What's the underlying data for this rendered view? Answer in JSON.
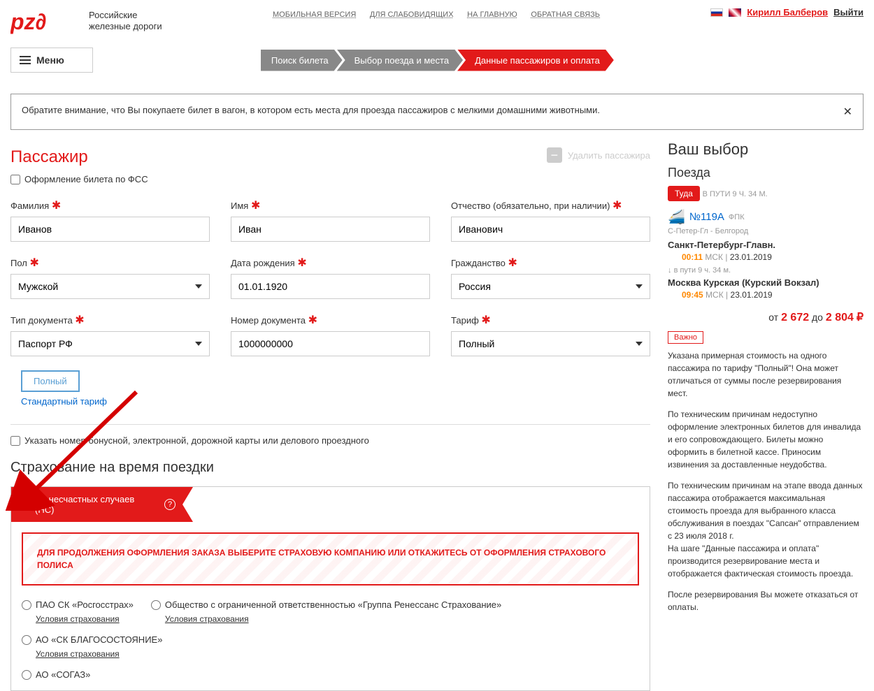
{
  "header": {
    "logo_line1": "Российские",
    "logo_line2": "железные дороги",
    "top_links": [
      "МОБИЛЬНАЯ ВЕРСИЯ",
      "ДЛЯ СЛАБОВИДЯЩИХ",
      "НА ГЛАВНУЮ",
      "ОБРАТНАЯ СВЯЗЬ"
    ],
    "username": "Кирилл Балберов",
    "logout": "Выйти",
    "menu": "Меню"
  },
  "breadcrumbs": [
    "Поиск билета",
    "Выбор поезда и места",
    "Данные пассажиров и оплата"
  ],
  "notice": "Обратите внимание, что Вы покупаете билет в вагон, в котором есть места для проезда пассажиров с мелкими домашними животными.",
  "passenger": {
    "title": "Пассажир",
    "delete": "Удалить пассажира",
    "fss_checkbox": "Оформление билета по ФСС",
    "surname_label": "Фамилия",
    "surname_value": "Иванов",
    "name_label": "Имя",
    "name_value": "Иван",
    "patronymic_label": "Отчество (обязательно, при наличии)",
    "patronymic_value": "Иванович",
    "sex_label": "Пол",
    "sex_value": "Мужской",
    "dob_label": "Дата рождения",
    "dob_value": "01.01.1920",
    "citizenship_label": "Гражданство",
    "citizenship_value": "Россия",
    "doc_type_label": "Тип документа",
    "doc_type_value": "Паспорт РФ",
    "doc_num_label": "Номер документа",
    "doc_num_value": "1000000000",
    "tariff_label": "Тариф",
    "tariff_value": "Полный",
    "tariff_box": "Полный",
    "tariff_link": "Стандартный тариф",
    "bonus_checkbox": "Указать номер бонусной, электронной, дорожной карты или делового проездного"
  },
  "insurance": {
    "title": "Страхование на время поездки",
    "ribbon": "От несчастных случаев (НС)",
    "warning": "ДЛЯ ПРОДОЛЖЕНИЯ ОФОРМЛЕНИЯ ЗАКАЗА ВЫБЕРИТЕ СТРАХОВУЮ КОМПАНИЮ ИЛИ ОТКАЖИТЕСЬ ОТ ОФОРМЛЕНИЯ СТРАХОВОГО ПОЛИСА",
    "conditions": "Условия страхования",
    "opt1": "ПАО СК «Росгосстрах»",
    "opt2": "Общество с ограниченной ответственностью «Группа Ренессанс Страхование»",
    "opt3": "АО «СК БЛАГОСОСТОЯНИЕ»",
    "opt4": "АО «СОГАЗ»"
  },
  "sidebar": {
    "title": "Ваш выбор",
    "trains": "Поезда",
    "direction": "Туда",
    "travel_time": "В ПУТИ 9 Ч. 34 М.",
    "train_num": "№119А",
    "fpk": "ФПК",
    "route": "С-Петер-Гл - Белгород",
    "station_from": "Санкт-Петербург-Главн.",
    "time_from": "00:11",
    "tz": "МСК",
    "date_from": "23.01.2019",
    "duration": "в пути  9 ч. 34 м.",
    "station_to": "Москва Курская (Курский Вокзал)",
    "time_to": "09:45",
    "date_to": "23.01.2019",
    "price_from_label": "от",
    "price_from": "2 672",
    "price_to_label": "до",
    "price_to": "2 804",
    "currency": "₽",
    "important": "Важно",
    "info1": "Указана примерная стоимость на одного пассажира по тарифу \"Полный\"! Она может отличаться от суммы после резервирования мест.",
    "info2": "По техническим причинам недоступно оформление электронных билетов для инвалида и его сопровождающего. Билеты можно оформить в билетной кассе. Приносим извинения за доставленные неудобства.",
    "info3": "По техническим причинам на этапе ввода данных пассажира отображается максимальная стоимость проезда для выбранного класса обслуживания в поездах \"Сапсан\" отправлением с 23 июля 2018 г.\nНа шаге \"Данные пассажира и оплата\" производится резервирование места и отображается фактическая стоимость проезда.",
    "info4": "После резервирования Вы можете отказаться от оплаты."
  }
}
